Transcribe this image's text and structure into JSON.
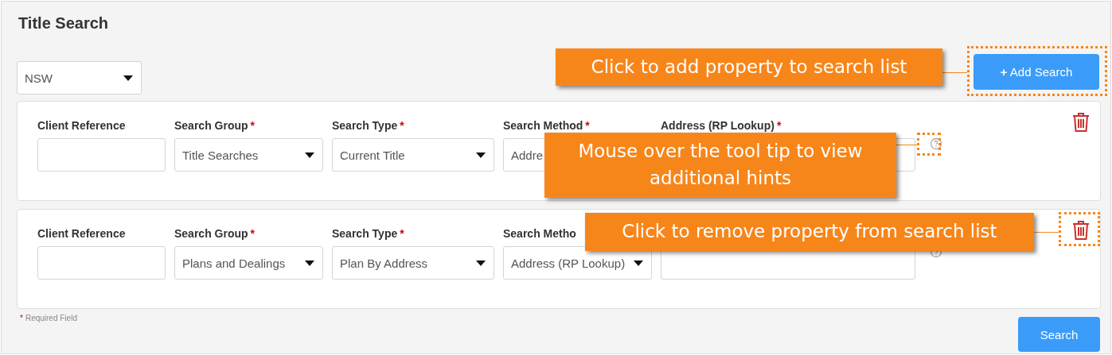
{
  "title": "Title Search",
  "state_select": {
    "value": "NSW"
  },
  "add_button": {
    "label": "**+** Add Search"
  },
  "rows": [
    {
      "fields": [
        {
          "kind": "text",
          "label": "Client Reference",
          "required": false
        },
        {
          "kind": "select",
          "label": "Search Group",
          "required": true,
          "value": "Title Searches"
        },
        {
          "kind": "select",
          "label": "Search Type",
          "required": true,
          "value": "Current Title"
        },
        {
          "kind": "select",
          "label": "Search Method",
          "required": true,
          "value": "Addre"
        },
        {
          "kind": "text",
          "label": "Address (RP Lookup)",
          "required": true
        }
      ]
    },
    {
      "fields": [
        {
          "kind": "text",
          "label": "Client Reference",
          "required": false
        },
        {
          "kind": "select",
          "label": "Search Group",
          "required": true,
          "value": "Plans and Dealings"
        },
        {
          "kind": "select",
          "label": "Search Type",
          "required": true,
          "value": "Plan By Address"
        },
        {
          "kind": "select",
          "label": "Search Metho",
          "value": "Address (RP Lookup)"
        },
        {
          "kind": "text"
        }
      ]
    }
  ],
  "required_note": {
    "mark": "*",
    "text": "Required Field"
  },
  "search_button": {
    "label": "Search"
  },
  "callouts": [
    {
      "text": "Click to add property to search list"
    },
    {
      "text": "Mouse over the tool tip to view additional hints"
    },
    {
      "text": "Click to remove property from search list"
    }
  ]
}
